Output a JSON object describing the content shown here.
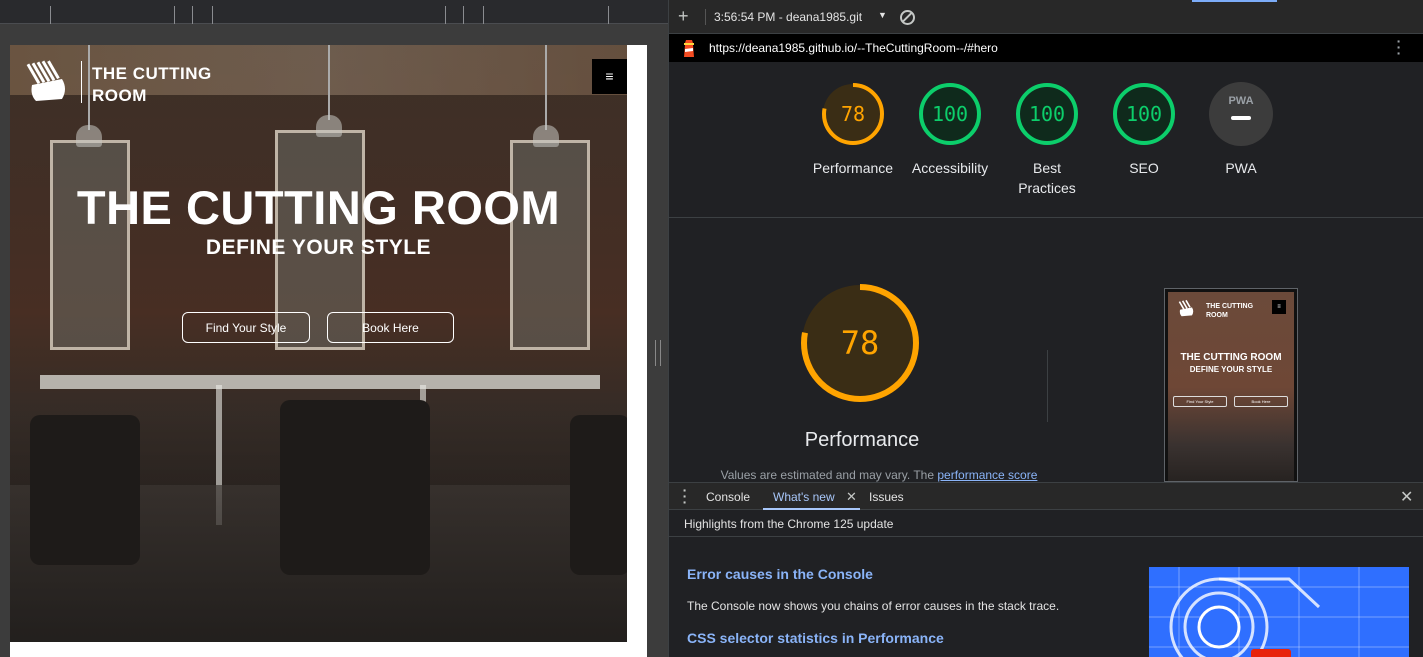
{
  "site": {
    "brand_line1": "THE CUTTING",
    "brand_line2": "ROOM",
    "menu_glyph": "≡",
    "hero_title": "THE CUTTING ROOM",
    "hero_subtitle": "DEFINE YOUR STYLE",
    "buttons": [
      "Find Your Style",
      "Book Here"
    ]
  },
  "devtools": {
    "report_label": "3:56:54 PM - deana1985.git",
    "url": "https://deana1985.github.io/--TheCuttingRoom--/#hero",
    "scores": [
      {
        "label": "Performance",
        "value": "78",
        "score": 78,
        "color": "#ffa400"
      },
      {
        "label": "Accessibility",
        "value": "100",
        "score": 100,
        "color": "#0cce6b"
      },
      {
        "label": "Best Practices",
        "value": "100",
        "score": 100,
        "color": "#0cce6b"
      },
      {
        "label": "SEO",
        "value": "100",
        "score": 100,
        "color": "#0cce6b"
      },
      {
        "label": "PWA",
        "value": "",
        "score": null,
        "color": "#9aa0a6"
      }
    ],
    "pwa_badge": "PWA",
    "main_score": {
      "label": "Performance",
      "value": "78",
      "score": 78,
      "color": "#ffa400"
    },
    "note_prefix": "Values are estimated and may vary. The ",
    "note_link": "performance score",
    "drawer_tabs": [
      "Console",
      "What's new",
      "Issues"
    ],
    "active_tab": "What's new",
    "whats_new": {
      "header": "Highlights from the Chrome 125 update",
      "item1_title": "Error causes in the Console",
      "item1_body": "The Console now shows you chains of error causes in the stack trace.",
      "item2_title": "CSS selector statistics in Performance"
    }
  }
}
